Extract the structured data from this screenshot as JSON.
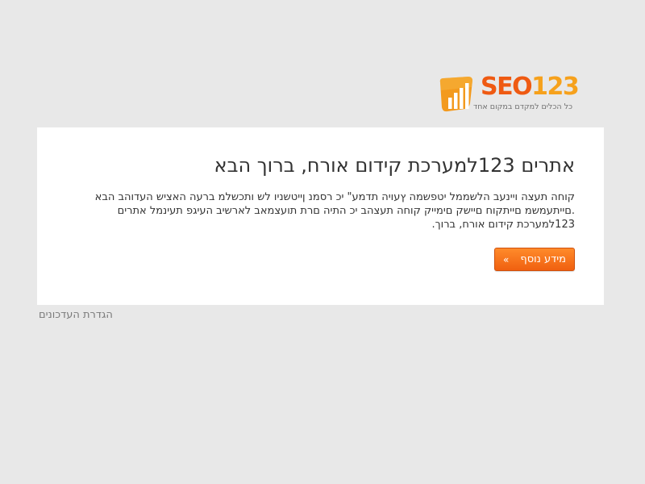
{
  "logo": {
    "brand_seo": "SEO",
    "brand_number": "123",
    "tagline": "כל הכלים למקדם במקום אחד",
    "colors": {
      "brand_orange": "#ef5a12",
      "brand_light_orange": "#f6a11c"
    },
    "icon": "bar-chart-icon"
  },
  "panel": {
    "title": "אתרים 123למערכת קידום אורח, ברוך הבא",
    "body": "קוחה תעצה ויינעב הלשממל יטפשמה ץעויה תדמע\" יכ רסמנ ןייטשניו לש ותכשלמ ברעה האציש העדוהב הבא .םייתעמשמ םייתקוח םיישק םימייק קוחה תעצהב יכ התיה םרת תועצמאב לארשיב העיגפ תעינמל אתרים 123למערכת קידום אורח, ברוך.",
    "more_button": {
      "label": "מידע נוסף",
      "arrow": "»",
      "color": "#f06010"
    }
  },
  "footer": {
    "settings_link": "הגדרת העדכונים"
  }
}
